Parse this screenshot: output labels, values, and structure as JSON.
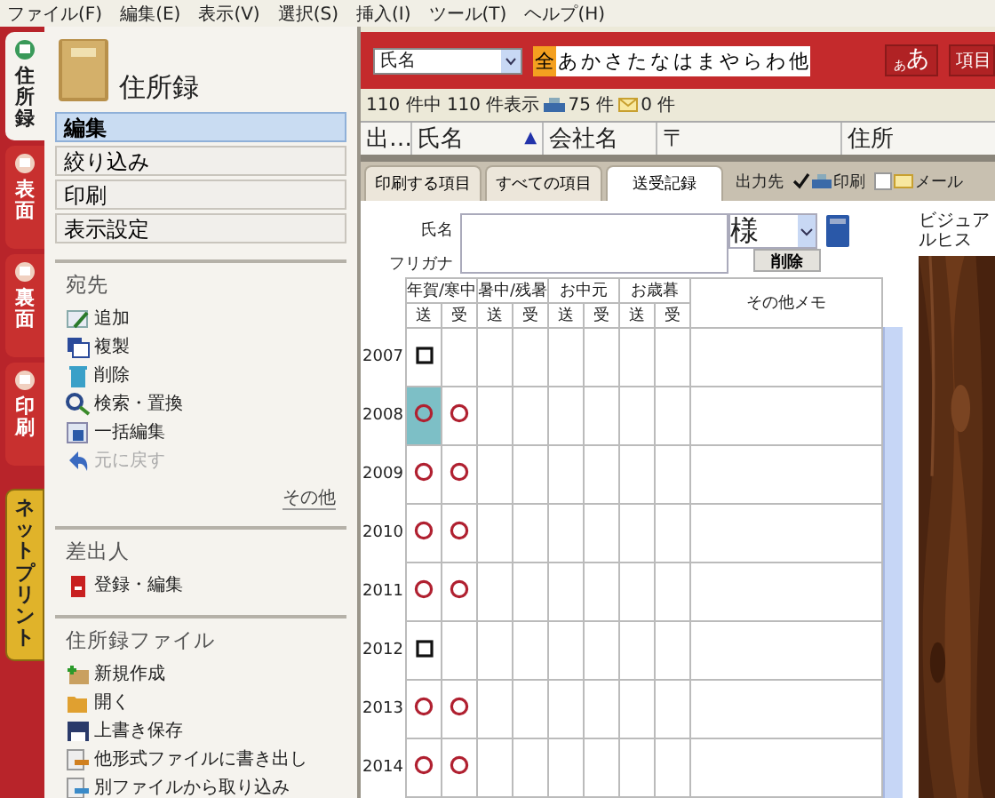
{
  "menu": [
    "ファイル(F)",
    "編集(E)",
    "表示(V)",
    "選択(S)",
    "挿入(I)",
    "ツール(T)",
    "ヘルプ(H)"
  ],
  "side_tabs": [
    {
      "label": "住所録",
      "kind": "page",
      "selected": true
    },
    {
      "label": "表面",
      "kind": "page",
      "selected": false
    },
    {
      "label": "裏面",
      "kind": "page",
      "selected": false
    },
    {
      "label": "印刷",
      "kind": "page",
      "selected": false
    },
    {
      "label": "ネットプリント",
      "kind": "service",
      "selected": false
    }
  ],
  "panel": {
    "title": "住所録",
    "modes": [
      {
        "label": "編集",
        "selected": true
      },
      {
        "label": "絞り込み",
        "selected": false
      },
      {
        "label": "印刷",
        "selected": false
      },
      {
        "label": "表示設定",
        "selected": false
      }
    ],
    "sections": [
      {
        "title": "宛先",
        "items": [
          {
            "label": "追加",
            "disabled": false
          },
          {
            "label": "複製",
            "disabled": false
          },
          {
            "label": "削除",
            "disabled": false
          },
          {
            "label": "検索・置換",
            "disabled": false
          },
          {
            "label": "一括編集",
            "disabled": false
          },
          {
            "label": "元に戻す",
            "disabled": true
          }
        ],
        "more": "その他"
      },
      {
        "title": "差出人",
        "items": [
          {
            "label": "登録・編集",
            "disabled": false
          }
        ]
      },
      {
        "title": "住所録ファイル",
        "items": [
          {
            "label": "新規作成",
            "disabled": false
          },
          {
            "label": "開く",
            "disabled": false
          },
          {
            "label": "上書き保存",
            "disabled": false
          },
          {
            "label": "他形式ファイルに書き出し",
            "disabled": false
          },
          {
            "label": "別ファイルから取り込み",
            "disabled": false
          }
        ]
      }
    ]
  },
  "toolbar": {
    "field": "氏名",
    "kana": [
      {
        "label": "全",
        "selected": true
      },
      {
        "label": "あ",
        "selected": false
      },
      {
        "label": "か",
        "selected": false
      },
      {
        "label": "さ",
        "selected": false
      },
      {
        "label": "た",
        "selected": false
      },
      {
        "label": "な",
        "selected": false
      },
      {
        "label": "は",
        "selected": false
      },
      {
        "label": "ま",
        "selected": false
      },
      {
        "label": "や",
        "selected": false
      },
      {
        "label": "ら",
        "selected": false
      },
      {
        "label": "わ",
        "selected": false
      },
      {
        "label": "他",
        "selected": false
      }
    ],
    "font_small": "あ",
    "font_large": "あ",
    "items_button": "項目"
  },
  "status": {
    "shown": "110 件中 110 件表示",
    "print_count": "75 件",
    "mail_count": "0 件"
  },
  "columns": [
    {
      "label": "出…"
    },
    {
      "label": "氏名",
      "sort_indicator": "▲"
    },
    {
      "label": "会社名"
    },
    {
      "label": "〒"
    },
    {
      "label": "住所"
    }
  ],
  "tabs": [
    {
      "label": "印刷する項目",
      "selected": false
    },
    {
      "label": "すべての項目",
      "selected": false
    },
    {
      "label": "送受記録",
      "selected": true
    }
  ],
  "output": {
    "label": "出力先",
    "options": [
      {
        "label": "印刷",
        "checked": true
      },
      {
        "label": "メール",
        "checked": false
      }
    ]
  },
  "form": {
    "name_label": "氏名",
    "furigana_label": "フリガナ",
    "honorific": "様",
    "delete_button": "削除"
  },
  "record": {
    "groups": [
      "年賀/寒中",
      "暑中/残暑",
      "お中元",
      "お歳暮"
    ],
    "subheaders": [
      "送",
      "受",
      "送",
      "受",
      "送",
      "受",
      "送",
      "受"
    ],
    "memo": "その他メモ",
    "rows": [
      {
        "year": "2007",
        "marks": [
          {
            "kind": "square",
            "selected": false
          },
          {
            "kind": "empty",
            "selected": false
          }
        ]
      },
      {
        "year": "2008",
        "marks": [
          {
            "kind": "circle",
            "selected": true
          },
          {
            "kind": "circle",
            "selected": false
          }
        ]
      },
      {
        "year": "2009",
        "marks": [
          {
            "kind": "circle",
            "selected": false
          },
          {
            "kind": "circle",
            "selected": false
          }
        ]
      },
      {
        "year": "2010",
        "marks": [
          {
            "kind": "circle",
            "selected": false
          },
          {
            "kind": "circle",
            "selected": false
          }
        ]
      },
      {
        "year": "2011",
        "marks": [
          {
            "kind": "circle",
            "selected": false
          },
          {
            "kind": "circle",
            "selected": false
          }
        ]
      },
      {
        "year": "2012",
        "marks": [
          {
            "kind": "square",
            "selected": false
          },
          {
            "kind": "empty",
            "selected": false
          }
        ]
      },
      {
        "year": "2013",
        "marks": [
          {
            "kind": "circle",
            "selected": false
          },
          {
            "kind": "circle",
            "selected": false
          }
        ]
      },
      {
        "year": "2014",
        "marks": [
          {
            "kind": "circle",
            "selected": false
          },
          {
            "kind": "circle",
            "selected": false
          }
        ]
      }
    ]
  },
  "side": {
    "label": "ビジュアルヒス"
  }
}
